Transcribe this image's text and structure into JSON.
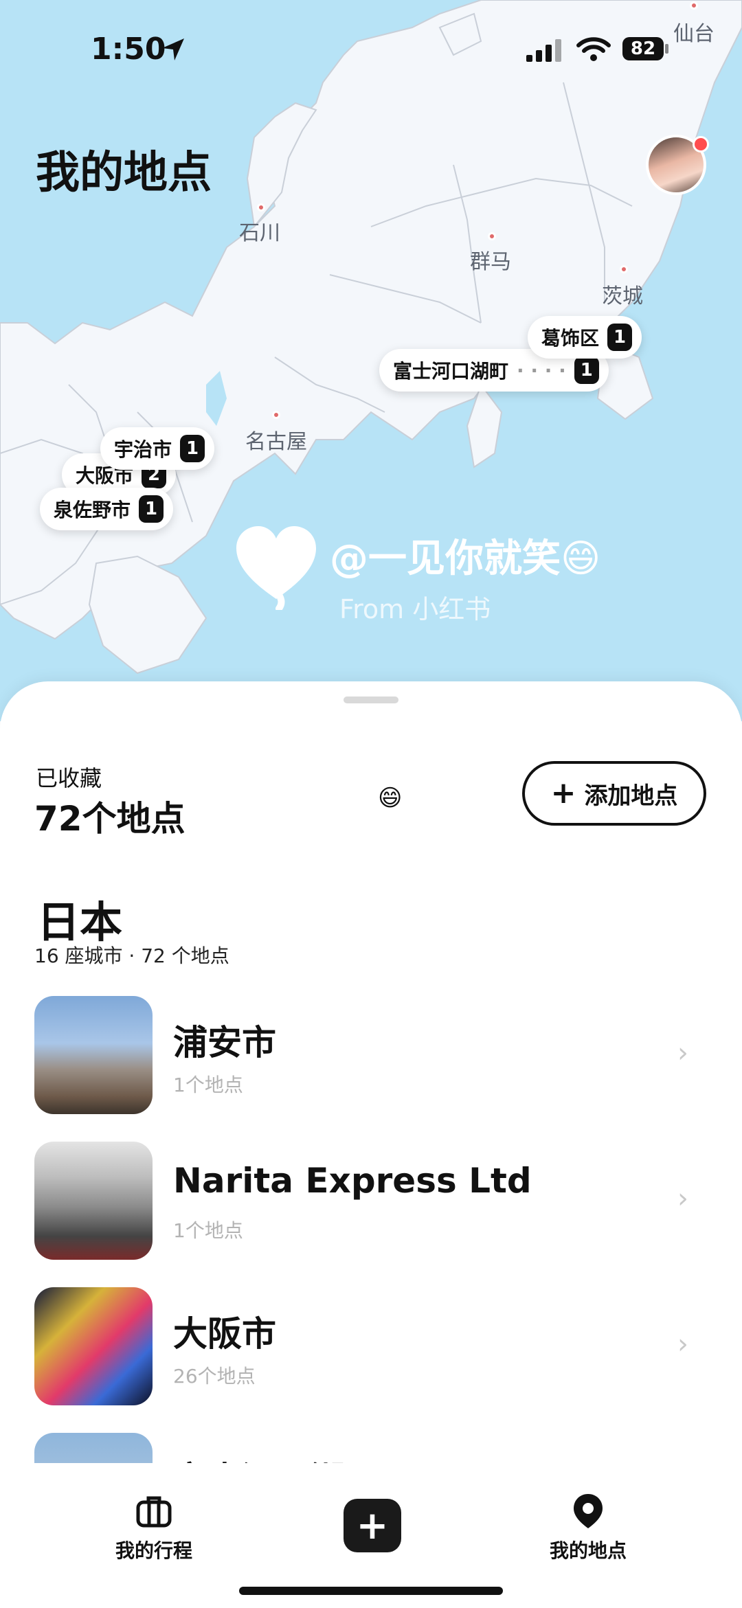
{
  "status_bar": {
    "time": "1:50",
    "battery": "82"
  },
  "map": {
    "title": "我的地点",
    "places": [
      "仙台",
      "石川",
      "群马",
      "茨城",
      "名古屋"
    ],
    "pins": [
      {
        "name": "葛饰区",
        "count": "1"
      },
      {
        "name": "富士河口湖町",
        "count": "1"
      },
      {
        "name": "宇治市",
        "count": "1"
      },
      {
        "name": "大阪市",
        "count": "2"
      },
      {
        "name": "泉佐野市",
        "count": "1"
      }
    ],
    "watermark": {
      "handle": "@一见你就笑😄",
      "from": "From 小红书"
    }
  },
  "sheet": {
    "saved_label": "已收藏",
    "saved_count": "72个地点",
    "emoji": "😄",
    "add_button": "添加地点",
    "country": "日本",
    "country_sub": "16 座城市 · 72 个地点",
    "cities": [
      {
        "name": "浦安市",
        "count": "1个地点"
      },
      {
        "name": "Narita Express Ltd",
        "count": "1个地点"
      },
      {
        "name": "大阪市",
        "count": "26个地点"
      },
      {
        "name": "富士河口湖町",
        "count": ""
      }
    ]
  },
  "tabbar": {
    "trips": "我的行程",
    "places": "我的地点"
  },
  "colors": {
    "sea": "#b7e3f6",
    "land": "#f4f7fb",
    "accent": "#111111"
  },
  "icons": [
    "location-arrow-icon",
    "signal-icon",
    "wifi-icon",
    "battery-icon",
    "heart-logo-icon",
    "plus-icon",
    "chevron-right-icon",
    "suitcase-icon",
    "plus-square-icon",
    "location-pin-icon"
  ]
}
